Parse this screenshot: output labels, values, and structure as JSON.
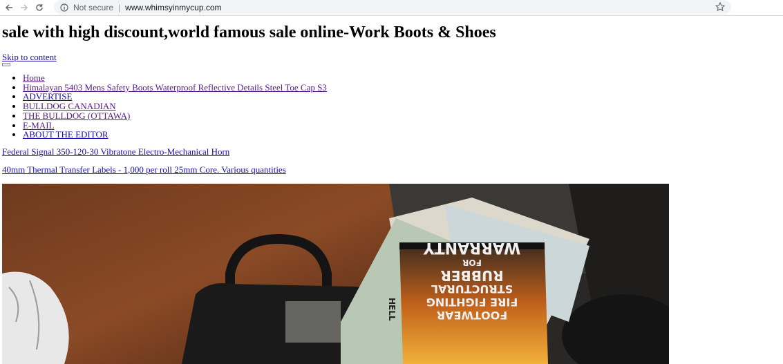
{
  "browser": {
    "security_label": "Not secure",
    "url": "www.whimsyinmycup.com"
  },
  "site_title": "sale with high discount,world famous sale online-Work Boots & Shoes",
  "skip_link": "Skip to content",
  "menu": {
    "items": [
      "Home",
      "Himalayan 5403 Mens Safety Boots Waterproof Reflective Details Steel Toe Cap S3",
      "ADVERTISE",
      "BULLDOG CANADIAN",
      "THE BULLDOG (OTTAWA)",
      "E-MAIL",
      "ABOUT THE EDITOR"
    ]
  },
  "posts": [
    "Federal Signal 350-120-30 Vibratone Electro-Mechanical Horn",
    "40mm Thermal Transfer Labels - 1,000 per roll 25mm Core. Various quantities"
  ],
  "image": {
    "book_text": [
      "WARRANTY",
      "FOR",
      "RUBBER",
      "STRUCTURAL",
      "FIRE FIGHTING",
      "FOOTWEAR"
    ],
    "side_text": "HELL"
  }
}
